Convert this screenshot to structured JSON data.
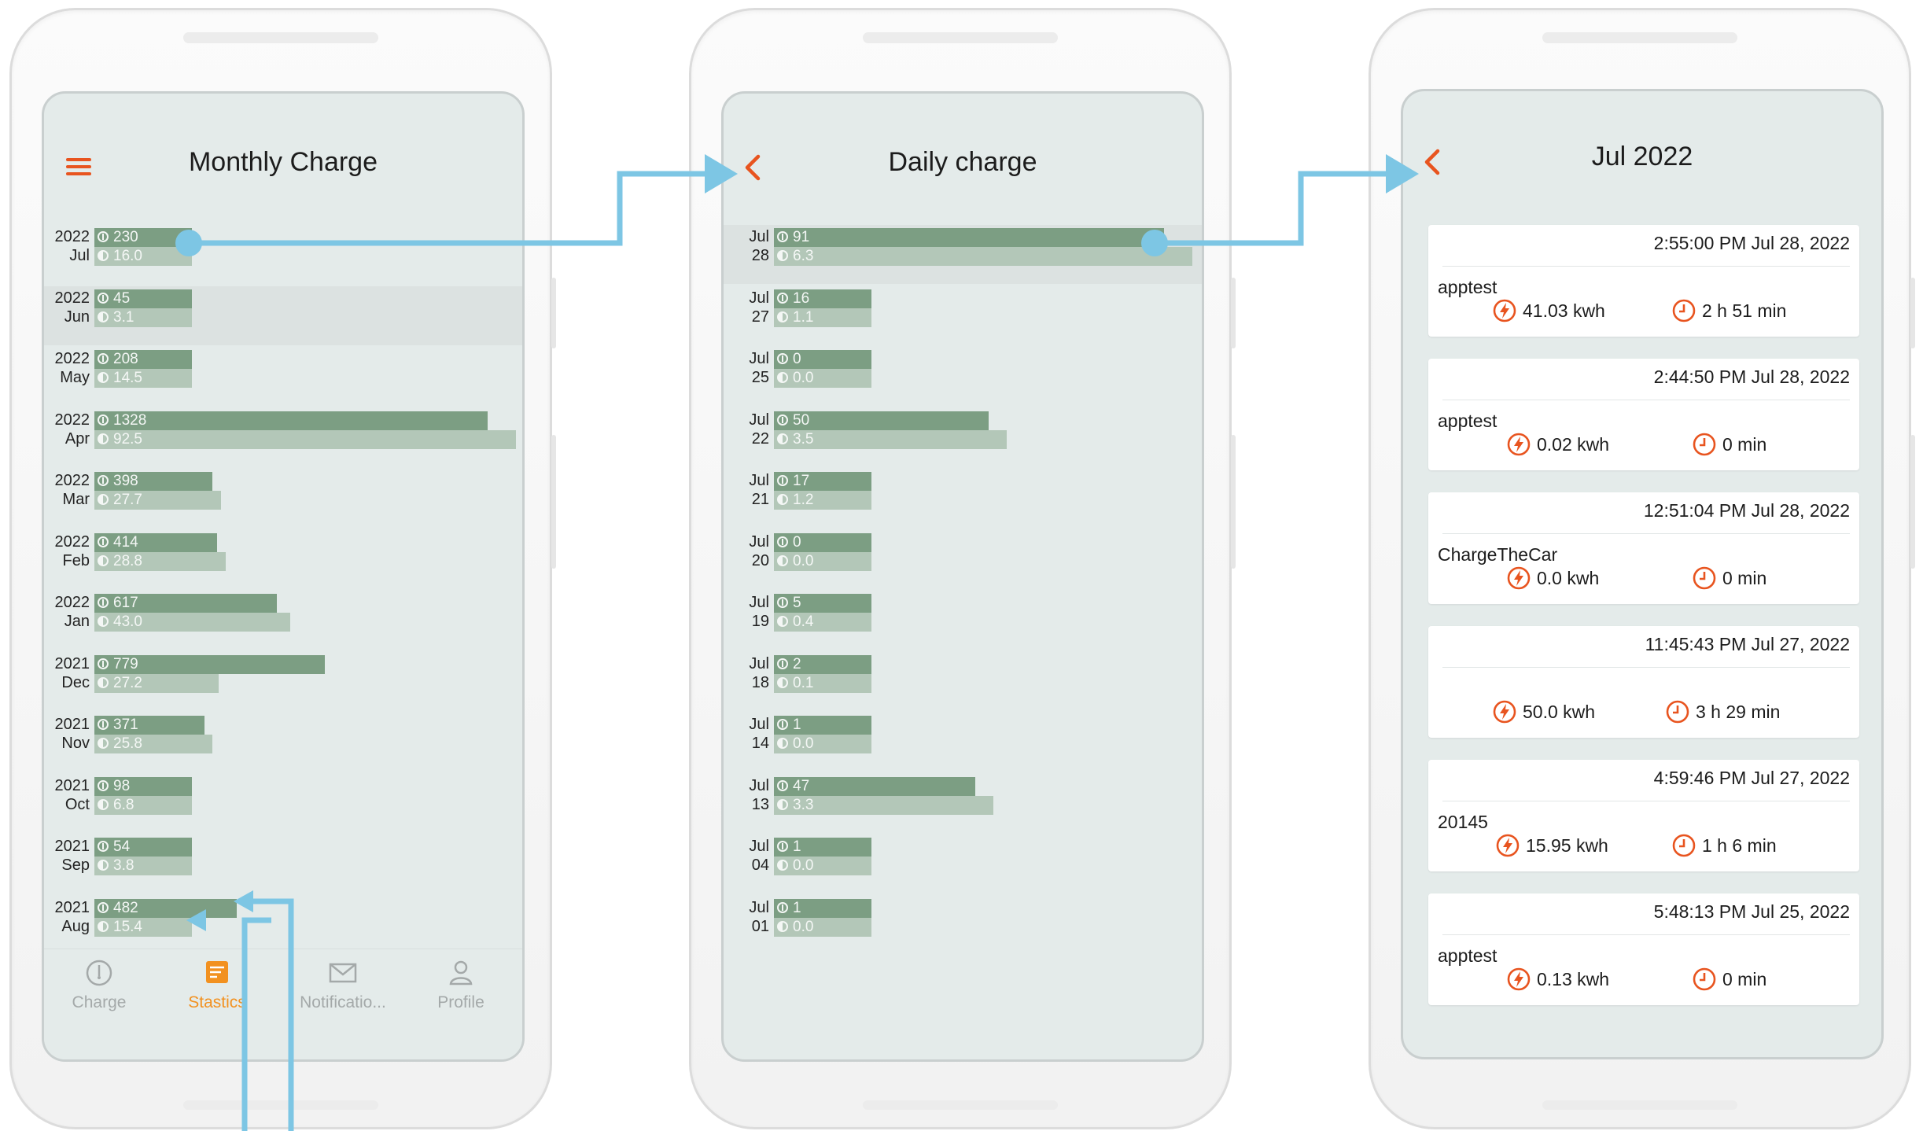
{
  "colors": {
    "accent": "#e8541f",
    "tab_active": "#f29120",
    "bar_primary": "#7c9e83",
    "bar_secondary": "#b3c7b8",
    "screen_bg": "#e4ebea",
    "flow_arrow": "#7dc6e4"
  },
  "monthly": {
    "title": "Monthly Charge",
    "menu_icon": "hamburger-menu-icon",
    "rows": [
      {
        "year": "2022",
        "month": "Jul",
        "primary": "230",
        "secondary": "16.0",
        "primary_value": 230,
        "secondary_value": 16.0
      },
      {
        "year": "2022",
        "month": "Jun",
        "primary": "45",
        "secondary": "3.1",
        "primary_value": 45,
        "secondary_value": 3.1
      },
      {
        "year": "2022",
        "month": "May",
        "primary": "208",
        "secondary": "14.5",
        "primary_value": 208,
        "secondary_value": 14.5
      },
      {
        "year": "2022",
        "month": "Apr",
        "primary": "1328",
        "secondary": "92.5",
        "primary_value": 1328,
        "secondary_value": 92.5
      },
      {
        "year": "2022",
        "month": "Mar",
        "primary": "398",
        "secondary": "27.7",
        "primary_value": 398,
        "secondary_value": 27.7
      },
      {
        "year": "2022",
        "month": "Feb",
        "primary": "414",
        "secondary": "28.8",
        "primary_value": 414,
        "secondary_value": 28.8
      },
      {
        "year": "2022",
        "month": "Jan",
        "primary": "617",
        "secondary": "43.0",
        "primary_value": 617,
        "secondary_value": 43.0
      },
      {
        "year": "2021",
        "month": "Dec",
        "primary": "779",
        "secondary": "27.2",
        "primary_value": 779,
        "secondary_value": 27.2
      },
      {
        "year": "2021",
        "month": "Nov",
        "primary": "371",
        "secondary": "25.8",
        "primary_value": 371,
        "secondary_value": 25.8
      },
      {
        "year": "2021",
        "month": "Oct",
        "primary": "98",
        "secondary": "6.8",
        "primary_value": 98,
        "secondary_value": 6.8
      },
      {
        "year": "2021",
        "month": "Sep",
        "primary": "54",
        "secondary": "3.8",
        "primary_value": 54,
        "secondary_value": 3.8
      },
      {
        "year": "2021",
        "month": "Aug",
        "primary": "482",
        "secondary": "15.4",
        "primary_value": 482,
        "secondary_value": 15.4
      }
    ],
    "tabs": [
      {
        "label": "Charge",
        "icon": "gauge-icon",
        "active": false
      },
      {
        "label": "Stastics",
        "icon": "statistics-icon",
        "active": true
      },
      {
        "label": "Notificatio...",
        "icon": "envelope-icon",
        "active": false
      },
      {
        "label": "Profile",
        "icon": "person-icon",
        "active": false
      }
    ]
  },
  "daily": {
    "title": "Daily charge",
    "back_icon": "chevron-left-icon",
    "rows": [
      {
        "month": "Jul",
        "day": "28",
        "primary": "91",
        "secondary": "6.3",
        "primary_value": 91,
        "secondary_value": 6.3
      },
      {
        "month": "Jul",
        "day": "27",
        "primary": "16",
        "secondary": "1.1",
        "primary_value": 16,
        "secondary_value": 1.1
      },
      {
        "month": "Jul",
        "day": "25",
        "primary": "0",
        "secondary": "0.0",
        "primary_value": 0,
        "secondary_value": 0.0
      },
      {
        "month": "Jul",
        "day": "22",
        "primary": "50",
        "secondary": "3.5",
        "primary_value": 50,
        "secondary_value": 3.5
      },
      {
        "month": "Jul",
        "day": "21",
        "primary": "17",
        "secondary": "1.2",
        "primary_value": 17,
        "secondary_value": 1.2
      },
      {
        "month": "Jul",
        "day": "20",
        "primary": "0",
        "secondary": "0.0",
        "primary_value": 0,
        "secondary_value": 0.0
      },
      {
        "month": "Jul",
        "day": "19",
        "primary": "5",
        "secondary": "0.4",
        "primary_value": 5,
        "secondary_value": 0.4
      },
      {
        "month": "Jul",
        "day": "18",
        "primary": "2",
        "secondary": "0.1",
        "primary_value": 2,
        "secondary_value": 0.1
      },
      {
        "month": "Jul",
        "day": "14",
        "primary": "1",
        "secondary": "0.0",
        "primary_value": 1,
        "secondary_value": 0.0
      },
      {
        "month": "Jul",
        "day": "13",
        "primary": "47",
        "secondary": "3.3",
        "primary_value": 47,
        "secondary_value": 3.3
      },
      {
        "month": "Jul",
        "day": "04",
        "primary": "1",
        "secondary": "0.0",
        "primary_value": 1,
        "secondary_value": 0.0
      },
      {
        "month": "Jul",
        "day": "01",
        "primary": "1",
        "secondary": "0.0",
        "primary_value": 1,
        "secondary_value": 0.0
      }
    ]
  },
  "sessions": {
    "title": "Jul 2022",
    "back_icon": "chevron-left-icon",
    "energy_icon": "lightning-icon",
    "duration_icon": "clock-icon",
    "items": [
      {
        "time": "2:55:00 PM Jul 28, 2022",
        "name": "apptest",
        "energy": "41.03 kwh",
        "duration": "2 h 51 min"
      },
      {
        "time": "2:44:50 PM Jul 28, 2022",
        "name": "apptest",
        "energy": "0.02 kwh",
        "duration": "0 min"
      },
      {
        "time": "12:51:04 PM Jul 28, 2022",
        "name": "ChargeTheCar",
        "energy": "0.0 kwh",
        "duration": "0 min"
      },
      {
        "time": "11:45:43 PM Jul 27, 2022",
        "name": "",
        "energy": "50.0 kwh",
        "duration": "3 h 29 min"
      },
      {
        "time": "4:59:46 PM Jul 27, 2022",
        "name": "20145",
        "energy": "15.95 kwh",
        "duration": "1 h 6 min"
      },
      {
        "time": "5:48:13 PM Jul 25, 2022",
        "name": "apptest",
        "energy": "0.13 kwh",
        "duration": "0 min"
      }
    ]
  }
}
